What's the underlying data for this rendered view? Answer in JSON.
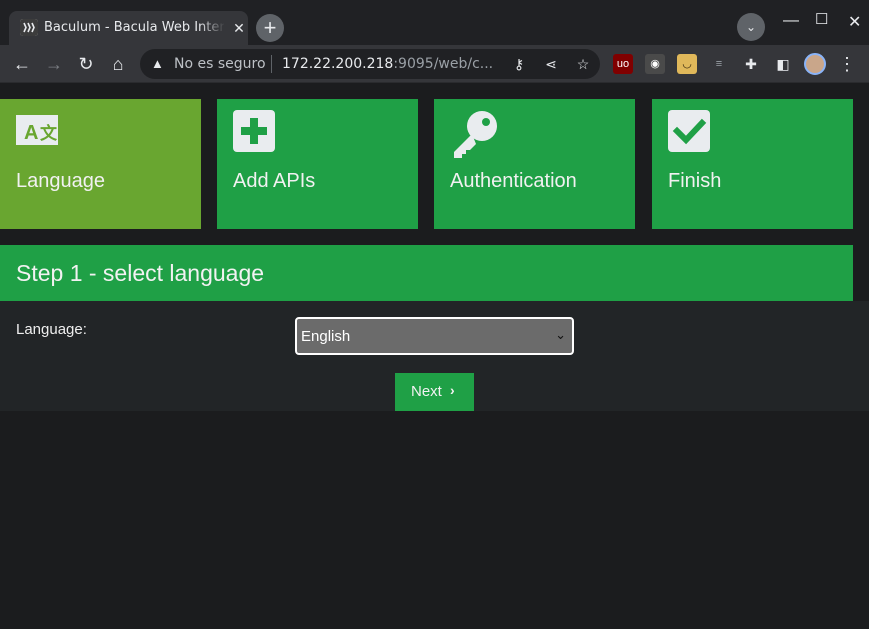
{
  "browser": {
    "tab_title": "Baculum - Bacula Web Interface",
    "security_label": "No es seguro",
    "url_host": "172.22.200.218",
    "url_rest": ":9095/web/c...",
    "icons": {
      "back": "arrow-left-icon",
      "forward": "arrow-right-icon",
      "reload": "reload-icon",
      "home": "home-icon",
      "key": "key-icon",
      "share": "share-icon",
      "bookmark": "star-icon"
    }
  },
  "wizard": {
    "steps": [
      {
        "label": "Language",
        "icon": "language-icon",
        "active": true
      },
      {
        "label": "Add APIs",
        "icon": "plus-square-icon",
        "active": false
      },
      {
        "label": "Authentication",
        "icon": "key-icon",
        "active": false
      },
      {
        "label": "Finish",
        "icon": "check-square-icon",
        "active": false
      }
    ],
    "step_title": "Step 1 - select language",
    "language_label": "Language:",
    "language_value": "English",
    "next_label": "Next"
  },
  "colors": {
    "green": "#1fa046",
    "active_green": "#69a630",
    "background": "#1b1c1e"
  }
}
